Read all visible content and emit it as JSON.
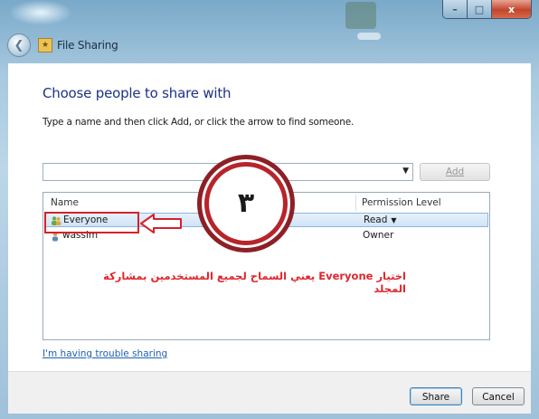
{
  "window": {
    "title": "File Sharing",
    "controls": {
      "minimize": "–",
      "maximize": "□",
      "close": "x"
    }
  },
  "dialog": {
    "heading": "Choose people to share with",
    "instruction": "Type a name and then click Add, or click the arrow to find someone.",
    "name_input": {
      "value": "",
      "placeholder": ""
    },
    "add_button": "Add",
    "columns": {
      "name": "Name",
      "permission": "Permission Level"
    },
    "rows": [
      {
        "name": "Everyone",
        "permission": "Read",
        "selected": true,
        "icon": "group-icon"
      },
      {
        "name": "wassim",
        "permission": "Owner",
        "selected": false,
        "icon": "user-icon"
      }
    ],
    "help_link": "I'm having trouble sharing",
    "share_button": "Share",
    "cancel_button": "Cancel"
  },
  "annotation": {
    "step_number": "٣",
    "note": "اختيار Everyone يعني السماح لجميع المستخدمين بمشاركة المجلد",
    "color": "#d2232a"
  }
}
